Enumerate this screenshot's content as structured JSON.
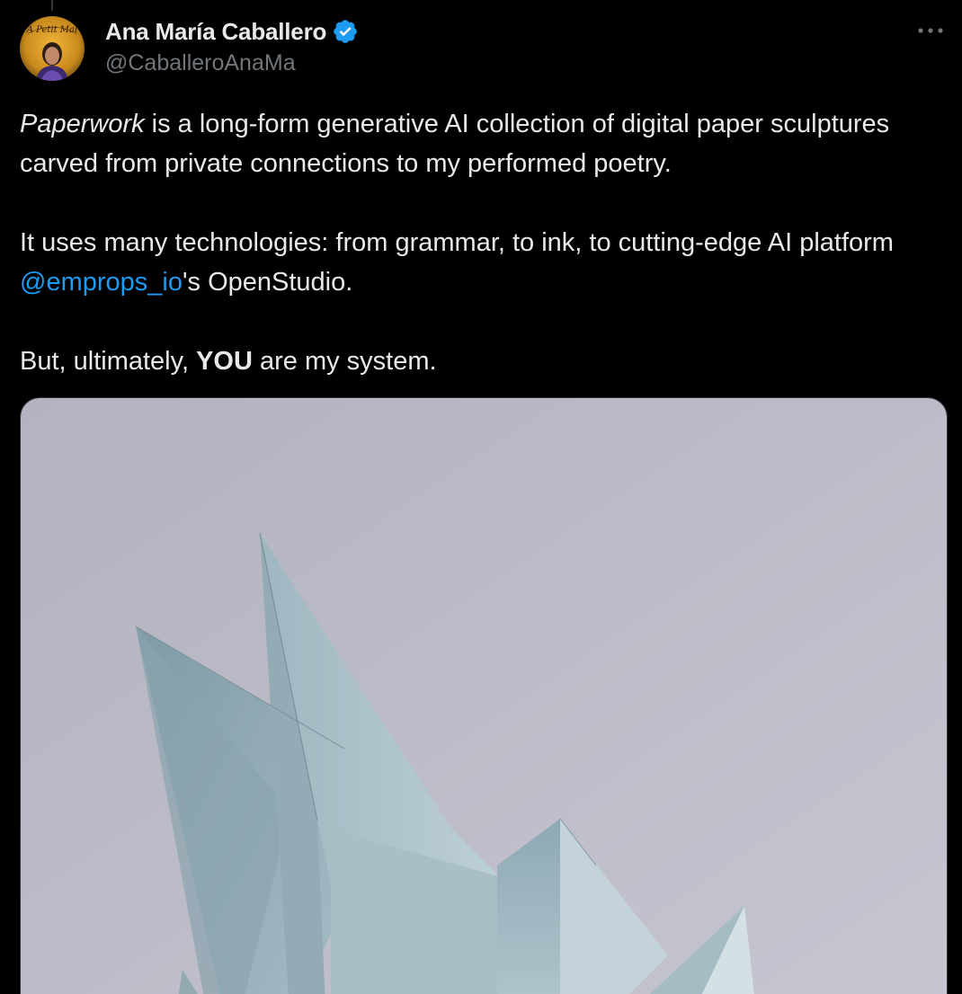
{
  "author": {
    "display_name": "Ana María Caballero",
    "handle": "@CaballeroAnaMa",
    "verified": true,
    "avatar_caption": "A Petit Mal"
  },
  "tweet": {
    "line1_italic": "Paperwork",
    "line1_rest": " is a long-form generative AI collection of digital paper sculptures carved from private connections to my performed poetry.",
    "line2_before": "It uses many technologies: from grammar, to ink, to cutting-edge AI platform ",
    "line2_mention": "@emprops_io",
    "line2_after": "'s OpenStudio.",
    "line3_before": "But, ultimately, ",
    "line3_bold": "YOU",
    "line3_after": " are my system."
  },
  "icons": {
    "verified": "verified-badge-icon",
    "more": "more-options-icon"
  },
  "colors": {
    "background": "#000000",
    "text": "#e7e9ea",
    "secondary": "#71767b",
    "accent": "#1d9bf0"
  }
}
